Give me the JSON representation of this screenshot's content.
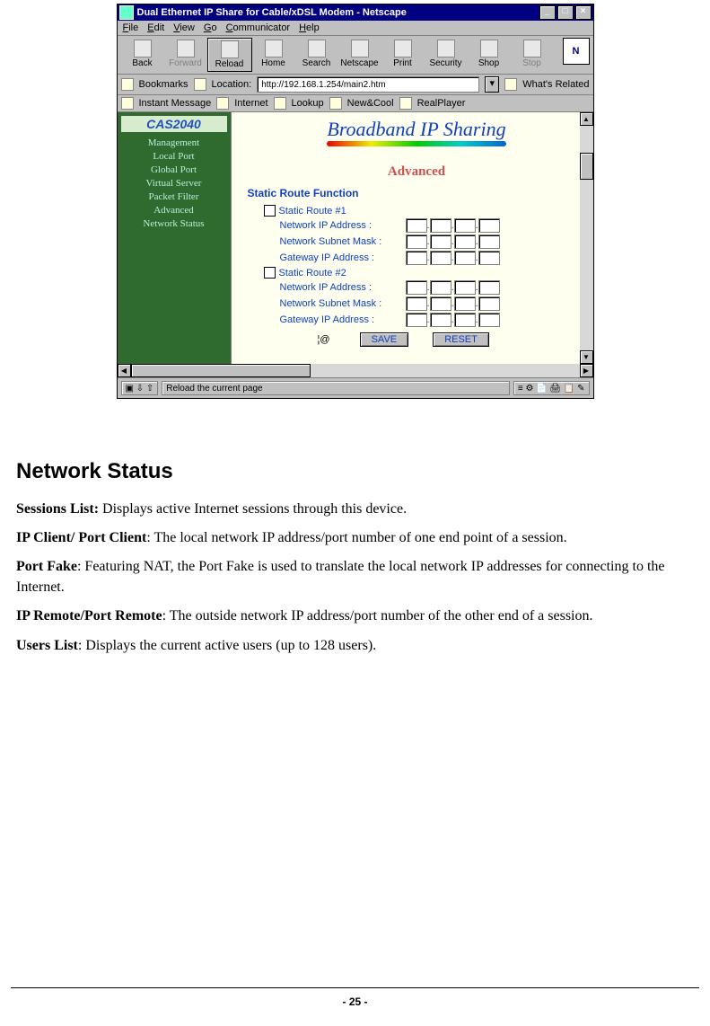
{
  "browser": {
    "title": "Dual Ethernet IP Share for Cable/xDSL Modem - Netscape",
    "menubar": [
      "File",
      "Edit",
      "View",
      "Go",
      "Communicator",
      "Help"
    ],
    "toolbar": [
      {
        "label": "Back",
        "name": "back-button"
      },
      {
        "label": "Forward",
        "name": "forward-button"
      },
      {
        "label": "Reload",
        "name": "reload-button"
      },
      {
        "label": "Home",
        "name": "home-button"
      },
      {
        "label": "Search",
        "name": "search-button"
      },
      {
        "label": "Netscape",
        "name": "netscape-button"
      },
      {
        "label": "Print",
        "name": "print-button"
      },
      {
        "label": "Security",
        "name": "security-button"
      },
      {
        "label": "Shop",
        "name": "shop-button"
      },
      {
        "label": "Stop",
        "name": "stop-button"
      }
    ],
    "bookmarks_label": "Bookmarks",
    "location_label": "Location:",
    "location_url": "http://192.168.1.254/main2.htm",
    "whats_related": "What's Related",
    "linksbar": [
      "Instant Message",
      "Internet",
      "Lookup",
      "New&Cool",
      "RealPlayer"
    ],
    "status": "Reload the current page"
  },
  "sidebar": {
    "brand": "CAS2040",
    "items": [
      "Management",
      "Local Port",
      "Global Port",
      "Virtual Server",
      "Packet Filter",
      "Advanced",
      "Network Status"
    ]
  },
  "mainpane": {
    "brand": "Broadband IP Sharing",
    "heading": "Advanced",
    "section": "Static Route Function",
    "route1_label": "Static Route #1",
    "route2_label": "Static Route #2",
    "field_ip": "Network IP Address :",
    "field_mask": "Network Subnet Mask :",
    "field_gw": "Gateway IP Address :",
    "save": "SAVE",
    "reset": "RESET"
  },
  "doc": {
    "title": "Network Status",
    "sessions_bold": "Sessions List:",
    "sessions_text": " Displays active Internet sessions through this device.",
    "ipclient_bold": "IP Client/ Port Client",
    "ipclient_text": ": The local network IP address/port number of one end point of a session.",
    "portfake_bold": "Port Fake",
    "portfake_text": ": Featuring NAT, the Port Fake is used to translate the local network IP addresses for connecting to the Internet.",
    "ipremote_bold": "IP Remote/Port Remote",
    "ipremote_text": ": The outside network IP address/port number of the other end of a session.",
    "users_bold": "Users List",
    "users_text": ": Displays the current active users (up to 128 users).",
    "page_number": "- 25 -"
  }
}
